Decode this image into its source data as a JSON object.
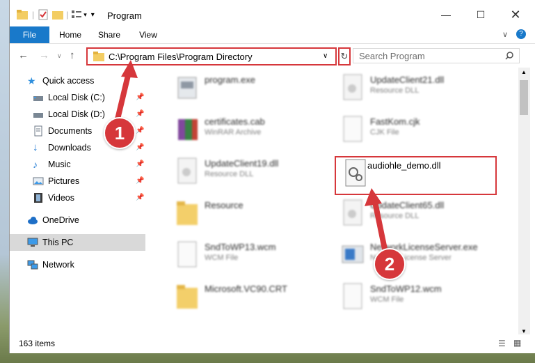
{
  "window": {
    "title": "Program"
  },
  "ribbon": {
    "tabs": [
      "File",
      "Home",
      "Share",
      "View"
    ]
  },
  "address": {
    "path": "C:\\Program Files\\Program Directory"
  },
  "search": {
    "placeholder": "Search Program"
  },
  "navpane": {
    "items": [
      {
        "label": "Quick access",
        "icon": "star-icon"
      },
      {
        "label": "Local Disk (C:)",
        "icon": "drive-icon"
      },
      {
        "label": "Local Disk (D:)",
        "icon": "drive-icon"
      },
      {
        "label": "Documents",
        "icon": "documents-icon"
      },
      {
        "label": "Downloads",
        "icon": "download-icon"
      },
      {
        "label": "Music",
        "icon": "music-icon"
      },
      {
        "label": "Pictures",
        "icon": "pictures-icon"
      },
      {
        "label": "Videos",
        "icon": "videos-icon"
      },
      {
        "label": "OneDrive",
        "icon": "cloud-icon"
      },
      {
        "label": "This PC",
        "icon": "computer-icon"
      },
      {
        "label": "Network",
        "icon": "network-icon"
      }
    ]
  },
  "files": [
    {
      "name": "program.exe",
      "type": ""
    },
    {
      "name": "UpdateClient21.dll",
      "type": "Resource DLL"
    },
    {
      "name": "certificates.cab",
      "type": "WinRAR Archive"
    },
    {
      "name": "FastKom.cjk",
      "type": "CJK File"
    },
    {
      "name": "UpdateClient19.dll",
      "type": "Resource DLL"
    },
    {
      "name": "audiohle_demo.dll",
      "type": ""
    },
    {
      "name": "Resource",
      "type": ""
    },
    {
      "name": "UpdateClient65.dll",
      "type": "Resource DLL"
    },
    {
      "name": "SndToWP13.wcm",
      "type": "WCM File"
    },
    {
      "name": "NetworkLicenseServer.exe",
      "type": "Network License Server"
    },
    {
      "name": "Microsoft.VC90.CRT",
      "type": ""
    },
    {
      "name": "SndToWP12.wcm",
      "type": "WCM File"
    }
  ],
  "status": {
    "count": "163 items"
  },
  "callouts": [
    "1",
    "2"
  ],
  "colors": {
    "accent": "#1979ca",
    "highlight": "#d6373b"
  }
}
